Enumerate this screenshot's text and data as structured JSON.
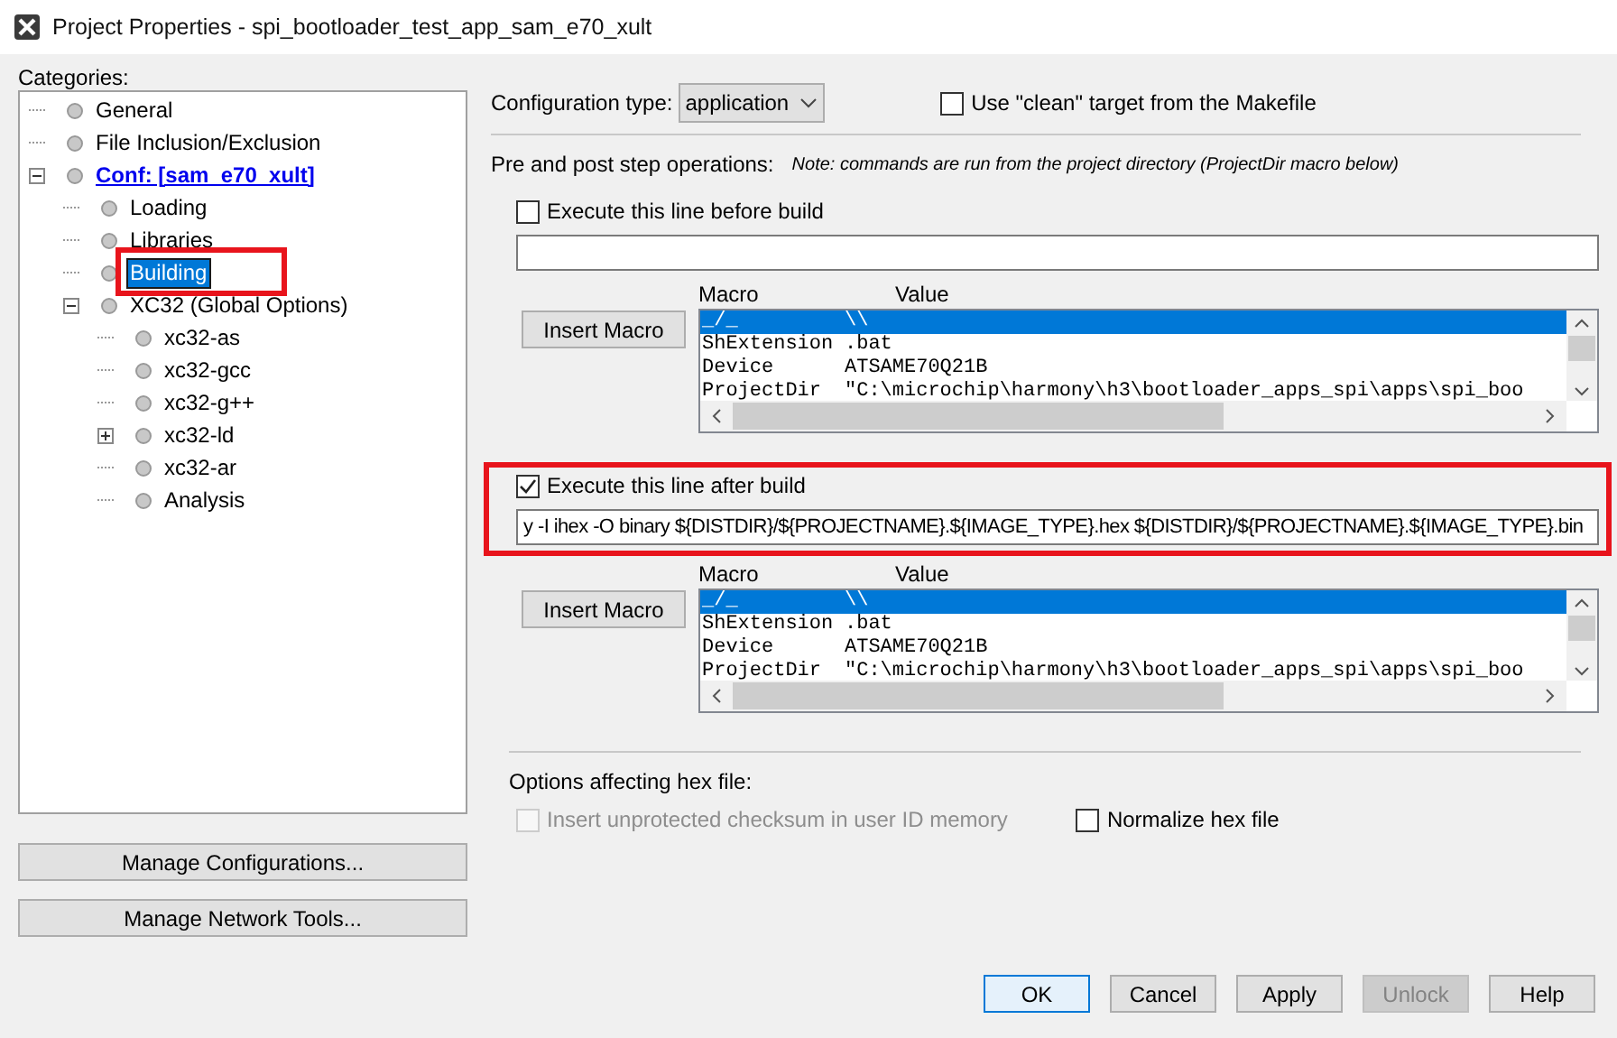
{
  "window": {
    "title": "Project Properties - spi_bootloader_test_app_sam_e70_xult"
  },
  "categories": {
    "label": "Categories:",
    "tree": [
      {
        "label": "General",
        "selected": false
      },
      {
        "label": "File Inclusion/Exclusion",
        "selected": false
      },
      {
        "label": "Conf: [sam_e70_xult]",
        "kind": "config",
        "selected": false,
        "expanded": true,
        "children": [
          {
            "label": "Loading",
            "selected": false
          },
          {
            "label": "Libraries",
            "selected": false
          },
          {
            "label": "Building",
            "selected": true,
            "callout": true
          },
          {
            "label": "XC32 (Global Options)",
            "selected": false,
            "expanded": true,
            "children": [
              {
                "label": "xc32-as",
                "selected": false
              },
              {
                "label": "xc32-gcc",
                "selected": false
              },
              {
                "label": "xc32-g++",
                "selected": false
              },
              {
                "label": "xc32-ld",
                "selected": false,
                "expanded": false
              },
              {
                "label": "xc32-ar",
                "selected": false
              },
              {
                "label": "Analysis",
                "selected": false
              }
            ]
          }
        ]
      }
    ]
  },
  "side_buttons": [
    "Manage Configurations...",
    "Manage Network Tools..."
  ],
  "configuration_type": {
    "label": "Configuration type:",
    "value": "application"
  },
  "clean_target": {
    "label": "Use \"clean\" target from the Makefile",
    "checked": false
  },
  "steps": {
    "label": "Pre and post step operations:",
    "note": "Note: commands are run from the project directory (ProjectDir macro below)",
    "sections": [
      {
        "label": "Execute this line before build",
        "checked": false,
        "macro_header": "Macro",
        "value_header": "Value",
        "button": "Insert Macro",
        "rows": [
          {
            "macro": "_/_",
            "value": "\\\\",
            "selected": true
          },
          {
            "macro": "ShExtension",
            "value": ".bat",
            "selected": false
          },
          {
            "macro": "Device",
            "value": "ATSAME70Q21B",
            "selected": false
          },
          {
            "macro": "ProjectDir",
            "value": "\"C:\\microchip\\harmony\\h3\\bootloader_apps_spi\\apps\\spi_boo",
            "selected": false
          }
        ]
      },
      {
        "label": "Execute this line after build",
        "checked": true,
        "callout": true,
        "value": "y -I ihex -O binary ${DISTDIR}/${PROJECTNAME}.${IMAGE_TYPE}.hex ${DISTDIR}/${PROJECTNAME}.${IMAGE_TYPE}.bin",
        "macro_header": "Macro",
        "value_header": "Value",
        "button": "Insert Macro",
        "rows": [
          {
            "macro": "_/_",
            "value": "\\\\",
            "selected": true
          },
          {
            "macro": "ShExtension",
            "value": ".bat",
            "selected": false
          },
          {
            "macro": "Device",
            "value": "ATSAME70Q21B",
            "selected": false
          },
          {
            "macro": "ProjectDir",
            "value": "\"C:\\microchip\\harmony\\h3\\bootloader_apps_spi\\apps\\spi_boo",
            "selected": false
          }
        ]
      }
    ]
  },
  "hex_options": {
    "label": "Options affecting hex file:",
    "options": [
      {
        "label": "Insert unprotected checksum in user ID memory",
        "checked": false,
        "disabled": true
      },
      {
        "label": "Normalize hex file",
        "checked": false,
        "disabled": false
      }
    ]
  },
  "buttons": [
    {
      "label": "OK",
      "default": true,
      "disabled": false
    },
    {
      "label": "Cancel",
      "default": false,
      "disabled": false
    },
    {
      "label": "Apply",
      "default": false,
      "disabled": false
    },
    {
      "label": "Unlock",
      "default": false,
      "disabled": true
    },
    {
      "label": "Help",
      "default": false,
      "disabled": false
    }
  ]
}
